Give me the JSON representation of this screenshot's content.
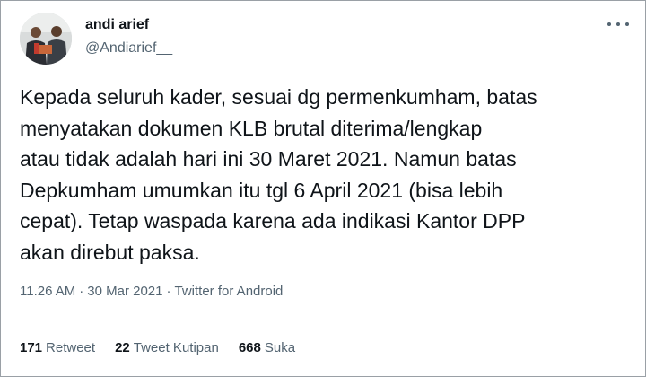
{
  "author": {
    "display_name": "andi arief",
    "handle": "@Andiarief__"
  },
  "tweet": {
    "text": "Kepada seluruh kader, sesuai dg permenkumham, batas\nmenyatakan dokumen KLB brutal diterima/lengkap\natau tidak adalah hari ini 30 Maret 2021. Namun batas\nDepkumham umumkan itu tgl 6 April 2021 (bisa lebih\ncepat). Tetap waspada karena ada indikasi Kantor DPP\nakan direbut paksa.",
    "time": "11.26 AM",
    "date": "30 Mar 2021",
    "source": "Twitter for Android",
    "separator": "·"
  },
  "stats": {
    "retweets_count": "171",
    "retweets_label": "Retweet",
    "quotes_count": "22",
    "quotes_label": "Tweet Kutipan",
    "likes_count": "668",
    "likes_label": "Suka"
  },
  "colors": {
    "text": "#0f1419",
    "secondary": "#536471",
    "divider": "#cfd9de"
  },
  "icons": {
    "more": "more-icon"
  }
}
